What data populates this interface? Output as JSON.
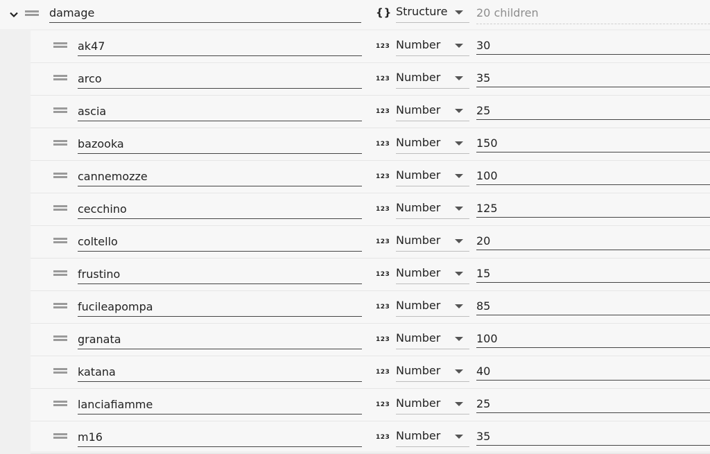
{
  "parent": {
    "name": "damage",
    "type": "Structure",
    "type_icon": "{}",
    "children_count": "20 children"
  },
  "type_icon_number": "123",
  "children": [
    {
      "name": "ak47",
      "type": "Number",
      "value": "30"
    },
    {
      "name": "arco",
      "type": "Number",
      "value": "35"
    },
    {
      "name": "ascia",
      "type": "Number",
      "value": "25"
    },
    {
      "name": "bazooka",
      "type": "Number",
      "value": "150"
    },
    {
      "name": "cannemozze",
      "type": "Number",
      "value": "100"
    },
    {
      "name": "cecchino",
      "type": "Number",
      "value": "125"
    },
    {
      "name": "coltello",
      "type": "Number",
      "value": "20"
    },
    {
      "name": "frustino",
      "type": "Number",
      "value": "15"
    },
    {
      "name": "fucileapompa",
      "type": "Number",
      "value": "85"
    },
    {
      "name": "granata",
      "type": "Number",
      "value": "100"
    },
    {
      "name": "katana",
      "type": "Number",
      "value": "40"
    },
    {
      "name": "lanciafiamme",
      "type": "Number",
      "value": "25"
    },
    {
      "name": "m16",
      "type": "Number",
      "value": "35"
    }
  ]
}
